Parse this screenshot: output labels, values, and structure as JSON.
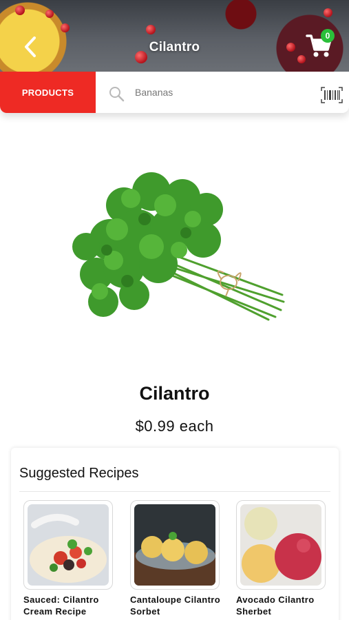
{
  "header": {
    "title": "Cilantro",
    "back_icon": "chevron-left-icon",
    "cart_icon": "cart-icon",
    "cart_count": "0"
  },
  "search": {
    "category_button": "PRODUCTS",
    "search_icon": "search-icon",
    "placeholder": "Bananas",
    "barcode_icon": "barcode-icon"
  },
  "product": {
    "name": "Cilantro",
    "price": "$0.99 each"
  },
  "recipes": {
    "title": "Suggested Recipes",
    "items": [
      {
        "name": "Sauced: Cilantro Cream Recipe"
      },
      {
        "name": "Cantaloupe Cilantro Sorbet"
      },
      {
        "name": "Avocado Cilantro Sherbet"
      }
    ]
  },
  "colors": {
    "accent": "#ee2a24",
    "badge": "#2bbf3a"
  }
}
